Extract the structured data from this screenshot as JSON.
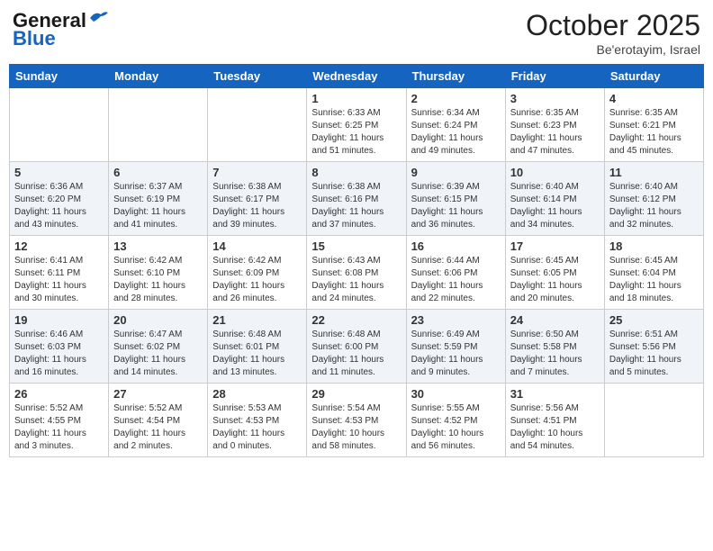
{
  "header": {
    "logo_line1": "General",
    "logo_line2": "Blue",
    "month": "October 2025",
    "location": "Be'erotayim, Israel"
  },
  "weekdays": [
    "Sunday",
    "Monday",
    "Tuesday",
    "Wednesday",
    "Thursday",
    "Friday",
    "Saturday"
  ],
  "weeks": [
    [
      {
        "day": "",
        "info": ""
      },
      {
        "day": "",
        "info": ""
      },
      {
        "day": "",
        "info": ""
      },
      {
        "day": "1",
        "info": "Sunrise: 6:33 AM\nSunset: 6:25 PM\nDaylight: 11 hours\nand 51 minutes."
      },
      {
        "day": "2",
        "info": "Sunrise: 6:34 AM\nSunset: 6:24 PM\nDaylight: 11 hours\nand 49 minutes."
      },
      {
        "day": "3",
        "info": "Sunrise: 6:35 AM\nSunset: 6:23 PM\nDaylight: 11 hours\nand 47 minutes."
      },
      {
        "day": "4",
        "info": "Sunrise: 6:35 AM\nSunset: 6:21 PM\nDaylight: 11 hours\nand 45 minutes."
      }
    ],
    [
      {
        "day": "5",
        "info": "Sunrise: 6:36 AM\nSunset: 6:20 PM\nDaylight: 11 hours\nand 43 minutes."
      },
      {
        "day": "6",
        "info": "Sunrise: 6:37 AM\nSunset: 6:19 PM\nDaylight: 11 hours\nand 41 minutes."
      },
      {
        "day": "7",
        "info": "Sunrise: 6:38 AM\nSunset: 6:17 PM\nDaylight: 11 hours\nand 39 minutes."
      },
      {
        "day": "8",
        "info": "Sunrise: 6:38 AM\nSunset: 6:16 PM\nDaylight: 11 hours\nand 37 minutes."
      },
      {
        "day": "9",
        "info": "Sunrise: 6:39 AM\nSunset: 6:15 PM\nDaylight: 11 hours\nand 36 minutes."
      },
      {
        "day": "10",
        "info": "Sunrise: 6:40 AM\nSunset: 6:14 PM\nDaylight: 11 hours\nand 34 minutes."
      },
      {
        "day": "11",
        "info": "Sunrise: 6:40 AM\nSunset: 6:12 PM\nDaylight: 11 hours\nand 32 minutes."
      }
    ],
    [
      {
        "day": "12",
        "info": "Sunrise: 6:41 AM\nSunset: 6:11 PM\nDaylight: 11 hours\nand 30 minutes."
      },
      {
        "day": "13",
        "info": "Sunrise: 6:42 AM\nSunset: 6:10 PM\nDaylight: 11 hours\nand 28 minutes."
      },
      {
        "day": "14",
        "info": "Sunrise: 6:42 AM\nSunset: 6:09 PM\nDaylight: 11 hours\nand 26 minutes."
      },
      {
        "day": "15",
        "info": "Sunrise: 6:43 AM\nSunset: 6:08 PM\nDaylight: 11 hours\nand 24 minutes."
      },
      {
        "day": "16",
        "info": "Sunrise: 6:44 AM\nSunset: 6:06 PM\nDaylight: 11 hours\nand 22 minutes."
      },
      {
        "day": "17",
        "info": "Sunrise: 6:45 AM\nSunset: 6:05 PM\nDaylight: 11 hours\nand 20 minutes."
      },
      {
        "day": "18",
        "info": "Sunrise: 6:45 AM\nSunset: 6:04 PM\nDaylight: 11 hours\nand 18 minutes."
      }
    ],
    [
      {
        "day": "19",
        "info": "Sunrise: 6:46 AM\nSunset: 6:03 PM\nDaylight: 11 hours\nand 16 minutes."
      },
      {
        "day": "20",
        "info": "Sunrise: 6:47 AM\nSunset: 6:02 PM\nDaylight: 11 hours\nand 14 minutes."
      },
      {
        "day": "21",
        "info": "Sunrise: 6:48 AM\nSunset: 6:01 PM\nDaylight: 11 hours\nand 13 minutes."
      },
      {
        "day": "22",
        "info": "Sunrise: 6:48 AM\nSunset: 6:00 PM\nDaylight: 11 hours\nand 11 minutes."
      },
      {
        "day": "23",
        "info": "Sunrise: 6:49 AM\nSunset: 5:59 PM\nDaylight: 11 hours\nand 9 minutes."
      },
      {
        "day": "24",
        "info": "Sunrise: 6:50 AM\nSunset: 5:58 PM\nDaylight: 11 hours\nand 7 minutes."
      },
      {
        "day": "25",
        "info": "Sunrise: 6:51 AM\nSunset: 5:56 PM\nDaylight: 11 hours\nand 5 minutes."
      }
    ],
    [
      {
        "day": "26",
        "info": "Sunrise: 5:52 AM\nSunset: 4:55 PM\nDaylight: 11 hours\nand 3 minutes."
      },
      {
        "day": "27",
        "info": "Sunrise: 5:52 AM\nSunset: 4:54 PM\nDaylight: 11 hours\nand 2 minutes."
      },
      {
        "day": "28",
        "info": "Sunrise: 5:53 AM\nSunset: 4:53 PM\nDaylight: 11 hours\nand 0 minutes."
      },
      {
        "day": "29",
        "info": "Sunrise: 5:54 AM\nSunset: 4:53 PM\nDaylight: 10 hours\nand 58 minutes."
      },
      {
        "day": "30",
        "info": "Sunrise: 5:55 AM\nSunset: 4:52 PM\nDaylight: 10 hours\nand 56 minutes."
      },
      {
        "day": "31",
        "info": "Sunrise: 5:56 AM\nSunset: 4:51 PM\nDaylight: 10 hours\nand 54 minutes."
      },
      {
        "day": "",
        "info": ""
      }
    ]
  ]
}
